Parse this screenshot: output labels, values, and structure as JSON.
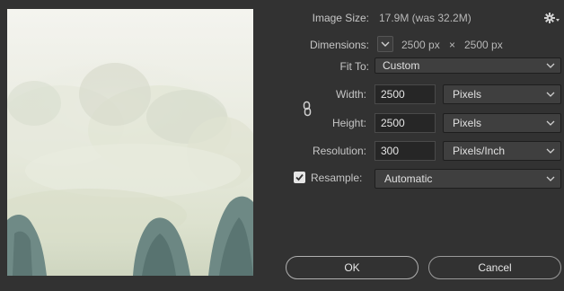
{
  "image_size": {
    "label": "Image Size:",
    "value": "17.9M (was 32.2M)"
  },
  "dimensions": {
    "label": "Dimensions:",
    "width_value": "2500 px",
    "separator": "×",
    "height_value": "2500 px"
  },
  "fit_to": {
    "label": "Fit To:",
    "selected": "Custom"
  },
  "width": {
    "label": "Width:",
    "value": "2500",
    "unit": "Pixels"
  },
  "height": {
    "label": "Height:",
    "value": "2500",
    "unit": "Pixels"
  },
  "resolution": {
    "label": "Resolution:",
    "value": "300",
    "unit": "Pixels/Inch"
  },
  "resample": {
    "label": "Resample:",
    "checked": true,
    "selected": "Automatic"
  },
  "buttons": {
    "ok": "OK",
    "cancel": "Cancel"
  },
  "icons": {
    "settings": "gear-icon",
    "link": "chain-link-icon",
    "dimensions_toggle": "chevron-down-icon",
    "resample_check": "checkmark-icon"
  },
  "colors": {
    "background": "#323232",
    "field_background": "#262626",
    "dropdown_background": "#3f3f3f",
    "text": "#c8c8c8"
  }
}
